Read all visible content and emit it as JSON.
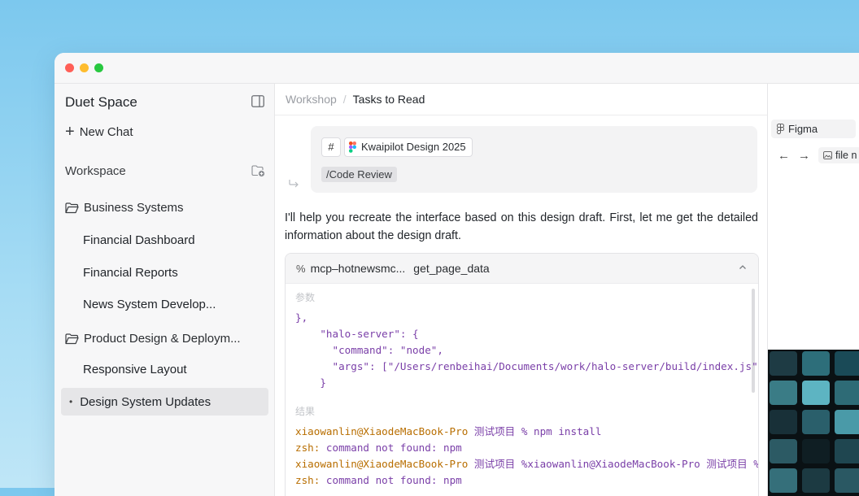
{
  "colors": {
    "accent_purple": "#7a3fa8",
    "accent_orange": "#b86e00",
    "sidebar_bg": "#f7f7f8"
  },
  "sidebar": {
    "title": "Duet Space",
    "new_chat": "New Chat",
    "workspace_label": "Workspace",
    "groups": [
      {
        "name": "Business Systems",
        "items": [
          "Financial Dashboard",
          "Financial Reports",
          "News System Develop..."
        ]
      },
      {
        "name": "Product Design & Deploym...",
        "items": [
          "Responsive Layout",
          "Design System Updates"
        ]
      }
    ],
    "active_item": "Design System Updates"
  },
  "breadcrumb": {
    "parent": "Workshop",
    "current": "Tasks to Read"
  },
  "user_message": {
    "hash": "#",
    "file": "Kwaipilot Design 2025",
    "command": "/Code Review"
  },
  "assistant_message": "I'll help you recreate the interface based on this design draft. First, let me get the detailed information about the design draft.",
  "tool_call": {
    "server": "mcp–hotnewsmc...",
    "function": "get_page_data",
    "params_label": "参数",
    "params_lines": [
      "},",
      "    \"halo-server\": {",
      "      \"command\": \"node\",",
      "      \"args\": [\"/Users/renbeihai/Documents/work/halo-server/build/index.js\"]",
      "    }"
    ],
    "result_label": "结果",
    "result_lines": [
      {
        "host": "xiaowanlin@XiaodeMacBook-Pro",
        "text": " 测试项目 % npm install"
      },
      {
        "host": "zsh:",
        "text": " command not found: npm"
      },
      {
        "host": "xiaowanlin@XiaodeMacBook-Pro",
        "text": " 测试项目 %xiaowanlin@XiaodeMacBook-Pro 测试项目 %"
      },
      {
        "host": "zsh:",
        "text": " command not found: npm"
      }
    ]
  },
  "right_panel": {
    "tab": "Figma",
    "file": "file n"
  }
}
